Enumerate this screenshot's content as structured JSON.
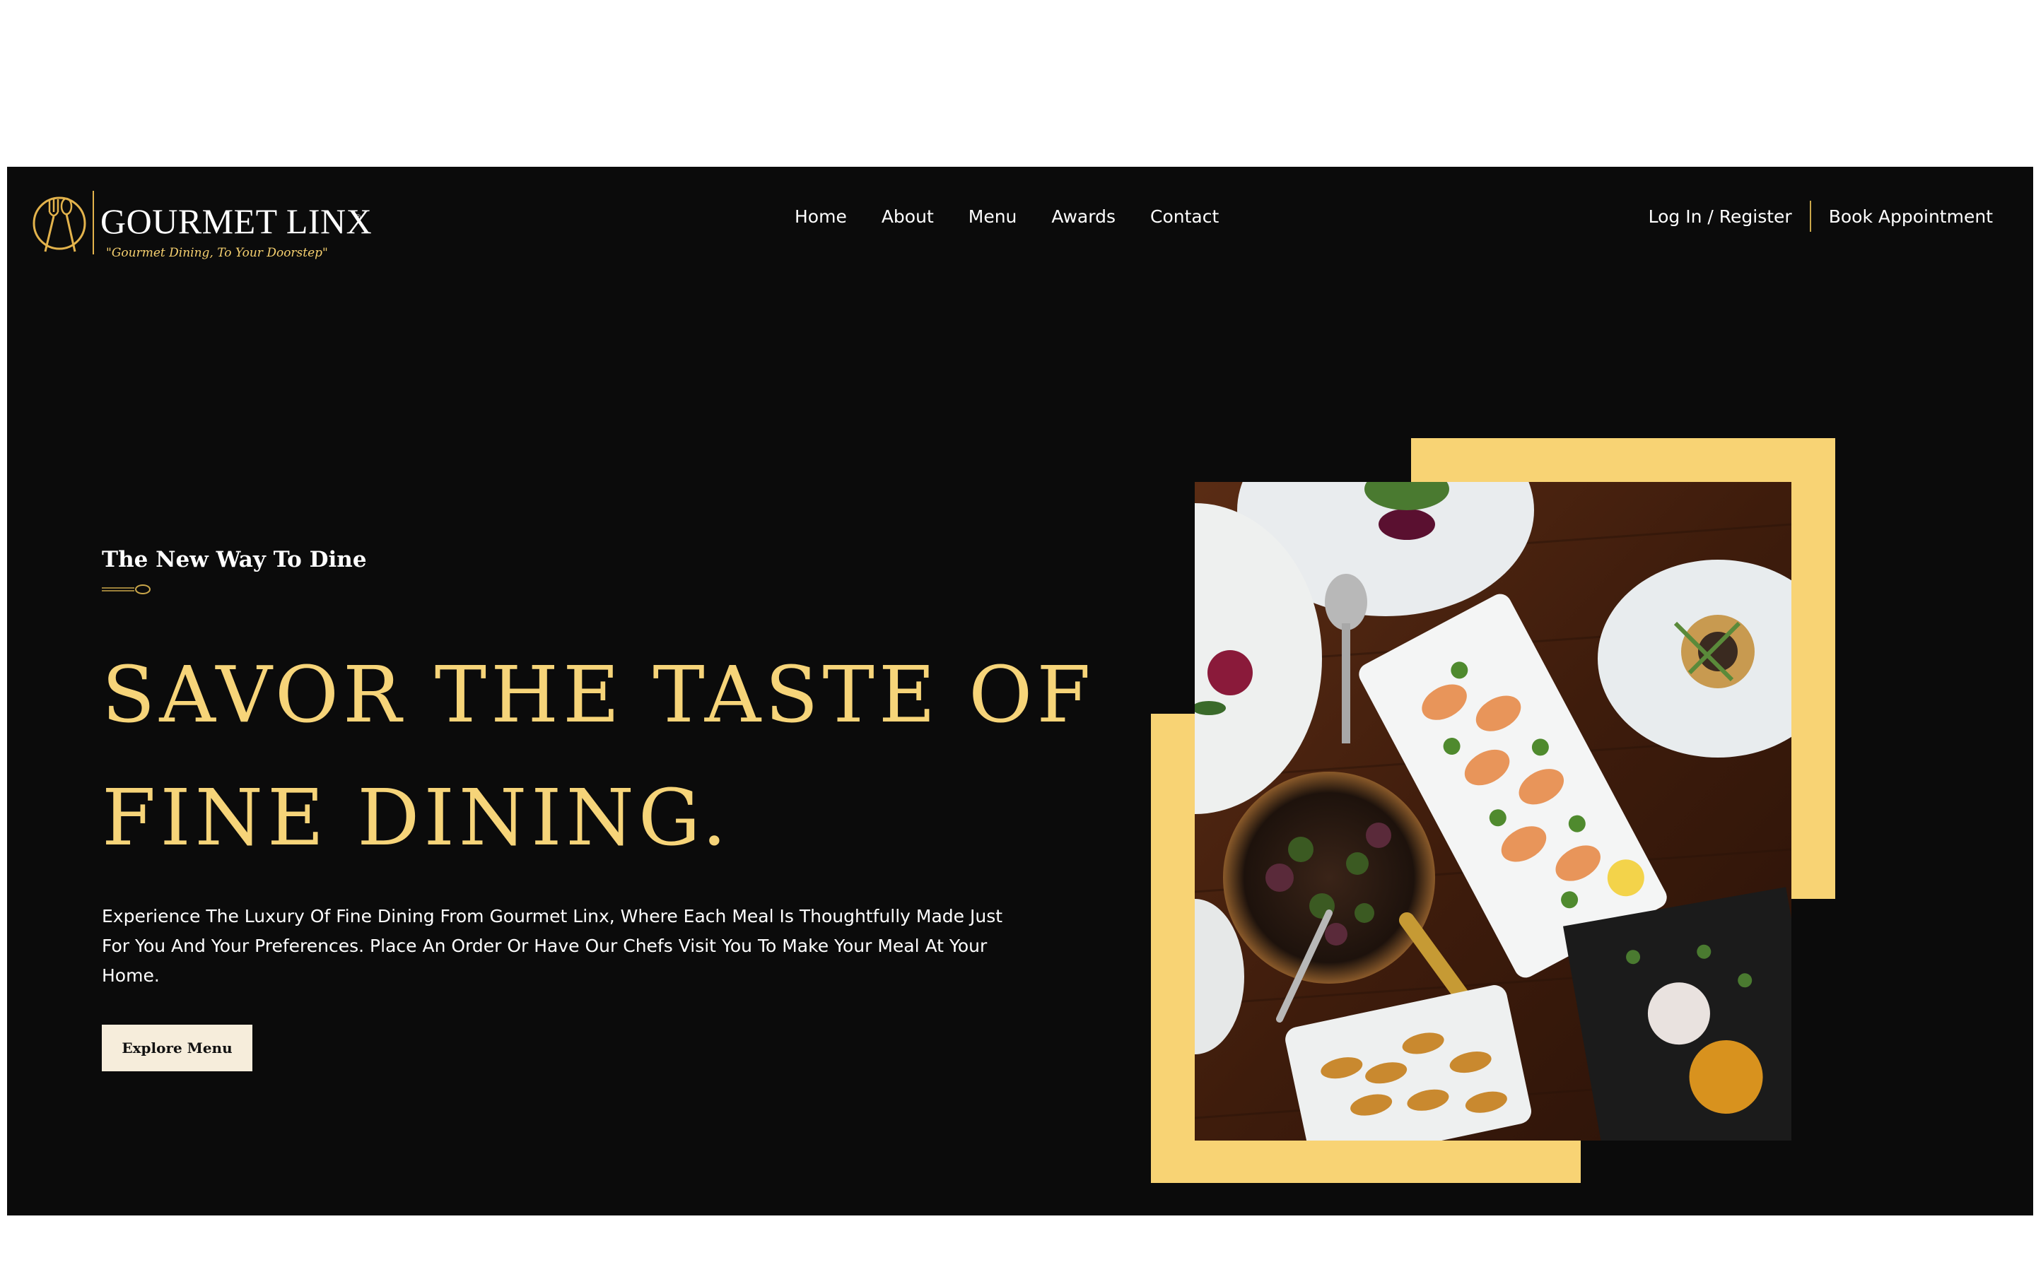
{
  "header": {
    "logo": {
      "name": "GOURMET LINX",
      "registered_mark": "®",
      "tagline": "\"Gourmet Dining, To Your Doorstep\""
    },
    "nav": [
      {
        "label": "Home"
      },
      {
        "label": "About"
      },
      {
        "label": "Menu"
      },
      {
        "label": "Awards"
      },
      {
        "label": "Contact"
      }
    ],
    "login_label": "Log In / Register",
    "book_label": "Book Appointment"
  },
  "hero": {
    "eyebrow": "The New Way To Dine",
    "headline_line1": "SAVOR THE TASTE OF",
    "headline_line2": "FINE DINING.",
    "description": "Experience The Luxury Of Fine Dining From Gourmet Linx, Where Each Meal Is Thoughtfully Made Just For You And Your Preferences. Place An Order Or Have Our Chefs Visit You To Make Your Meal At Your Home.",
    "button_label": "Explore Menu"
  },
  "icons": {
    "logo": "fork-spoon-emblem-icon",
    "eyebrow_divider": "spoon-icon"
  },
  "colors": {
    "background": "#0b0b0b",
    "accent_gold": "#f8d374",
    "headline_gold": "#f6d479",
    "button_bg": "#f6eddb",
    "text": "#ffffff"
  }
}
